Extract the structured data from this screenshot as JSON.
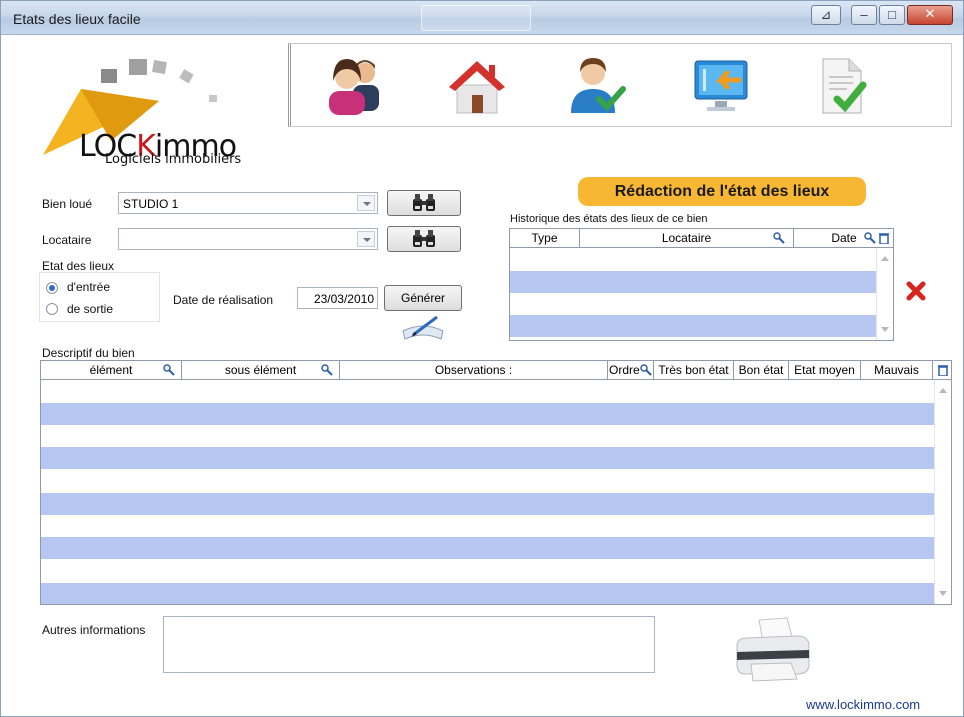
{
  "window": {
    "title": "Etats des lieux facile"
  },
  "logo": {
    "brand_black": "LOC",
    "brand_red": "K",
    "brand_rest": "immo",
    "tagline": "Logiciels immobiliers"
  },
  "toolbar": {
    "items": [
      {
        "icon": "people-icon"
      },
      {
        "icon": "house-icon"
      },
      {
        "icon": "user-check-icon"
      },
      {
        "icon": "import-screen-icon"
      },
      {
        "icon": "document-check-icon"
      }
    ]
  },
  "section_title": "Rédaction de l'état des lieux",
  "form": {
    "bien_loue_label": "Bien loué",
    "bien_loue_value": "STUDIO 1",
    "locataire_label": "Locataire",
    "locataire_value": "",
    "etat_group_label": "Etat des lieux",
    "radio_entree": "d'entrée",
    "radio_sortie": "de sortie",
    "selected": "entree",
    "date_label": "Date de réalisation",
    "date_value": "23/03/2010",
    "generate_label": "Générer"
  },
  "history": {
    "caption": "Historique des états des lieux de ce bien",
    "columns": [
      "Type",
      "Locataire",
      "Date"
    ],
    "rows": []
  },
  "descriptif": {
    "caption": "Descriptif du bien",
    "columns": [
      "élément",
      "sous élément",
      "Observations :",
      "Ordre",
      "Très bon état",
      "Bon état",
      "Etat moyen",
      "Mauvais"
    ],
    "rows": []
  },
  "autres": {
    "label": "Autres informations",
    "value": ""
  },
  "footer": {
    "url": "www.lockimmo.com"
  },
  "colors": {
    "accent": "#f7b733",
    "row_alt": "#b6c8f2",
    "brand_red": "#c8181e"
  }
}
